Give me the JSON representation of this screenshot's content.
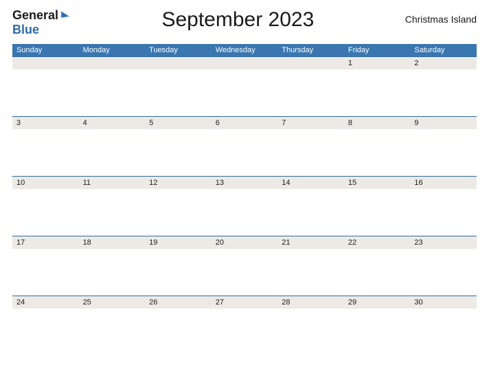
{
  "logo": {
    "text_part1": "General",
    "text_part2": "Blue"
  },
  "title": "September 2023",
  "location": "Christmas Island",
  "day_headers": [
    "Sunday",
    "Monday",
    "Tuesday",
    "Wednesday",
    "Thursday",
    "Friday",
    "Saturday"
  ],
  "weeks": [
    [
      "",
      "",
      "",
      "",
      "",
      "1",
      "2"
    ],
    [
      "3",
      "4",
      "5",
      "6",
      "7",
      "8",
      "9"
    ],
    [
      "10",
      "11",
      "12",
      "13",
      "14",
      "15",
      "16"
    ],
    [
      "17",
      "18",
      "19",
      "20",
      "21",
      "22",
      "23"
    ],
    [
      "24",
      "25",
      "26",
      "27",
      "28",
      "29",
      "30"
    ]
  ],
  "colors": {
    "header_bg": "#3a76b0",
    "number_row_bg": "#edeae5",
    "border": "#2e6aa8"
  }
}
